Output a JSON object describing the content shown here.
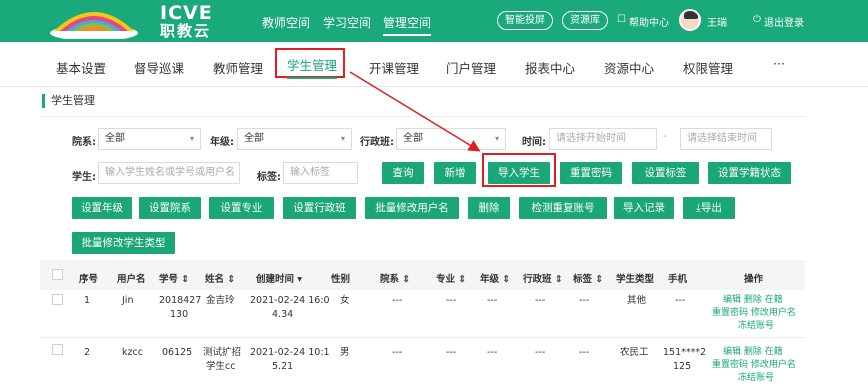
{
  "header": {
    "logo_en": "ICVE",
    "logo_cn": "职教云",
    "nav": [
      "教师空间",
      "学习空间",
      "管理空间"
    ],
    "pills": [
      "智能投屏",
      "资源库"
    ],
    "help": "帮助中心",
    "user": "王瑞",
    "logout": "退出登录",
    "brand_color": "#19a97a"
  },
  "subnav": {
    "items": [
      "基本设置",
      "督导巡课",
      "教师管理",
      "学生管理",
      "开课管理",
      "门户管理",
      "报表中心",
      "资源中心",
      "权限管理",
      "···"
    ],
    "active": "学生管理"
  },
  "panel": {
    "title": "学生管理"
  },
  "filters": {
    "college_label": "院系:",
    "college_value": "全部",
    "grade_label": "年级:",
    "grade_value": "全部",
    "class_label": "行政班:",
    "class_value": "全部",
    "time_label": "时间:",
    "start_placeholder": "请选择开始时间",
    "end_placeholder": "请选择结束时间",
    "student_label": "学生:",
    "student_placeholder": "输入学生姓名或学号或用户名",
    "tag_label": "标签:",
    "tag_placeholder": "输入标签"
  },
  "buttons": {
    "row1": [
      "查询",
      "新增",
      "导入学生",
      "重置密码",
      "设置标签",
      "设置学籍状态"
    ],
    "row2": [
      "设置年级",
      "设置院系",
      "设置专业",
      "设置行政班",
      "批量修改用户名",
      "删除",
      "检测重复账号",
      "导入记录",
      "导出"
    ],
    "row3": [
      "批量修改学生类型"
    ],
    "export_icon": "download-icon"
  },
  "table": {
    "headers": [
      "序号",
      "用户名",
      "学号 ⇕",
      "姓名 ⇕",
      "创建时间 ▾",
      "性别",
      "院系 ⇕",
      "专业 ⇕",
      "年级 ⇕",
      "行政班 ⇕",
      "标签 ⇕",
      "学生类型",
      "手机",
      "操作"
    ],
    "rows": [
      {
        "no": "1",
        "username": "Jin",
        "id": [
          "2018427",
          "130"
        ],
        "name": "金吉玲",
        "created": [
          "2021-02-24 16:0",
          "4.34"
        ],
        "gender": "女",
        "college": "---",
        "major": "---",
        "grade": "---",
        "class": "---",
        "tag": "---",
        "type": "其他",
        "phone": [
          "---"
        ],
        "ops": [
          "编辑 删除 在籍",
          "重置密码 修改用户名",
          "冻结账号"
        ]
      },
      {
        "no": "2",
        "username": "kzcc",
        "id": [
          "06125"
        ],
        "name": "测试扩招",
        "name2": "学生cc",
        "created": [
          "2021-02-24 10:1",
          "5.21"
        ],
        "gender": "男",
        "college": "---",
        "major": "---",
        "grade": "---",
        "class": "---",
        "tag": "---",
        "type": "农民工",
        "phone": [
          "151****2",
          "125"
        ],
        "ops": [
          "编辑 删除 在籍",
          "重置密码 修改用户名",
          "冻结账号"
        ]
      }
    ]
  },
  "colors": {
    "accent": "#1aa676",
    "highlight": "#e02020"
  }
}
